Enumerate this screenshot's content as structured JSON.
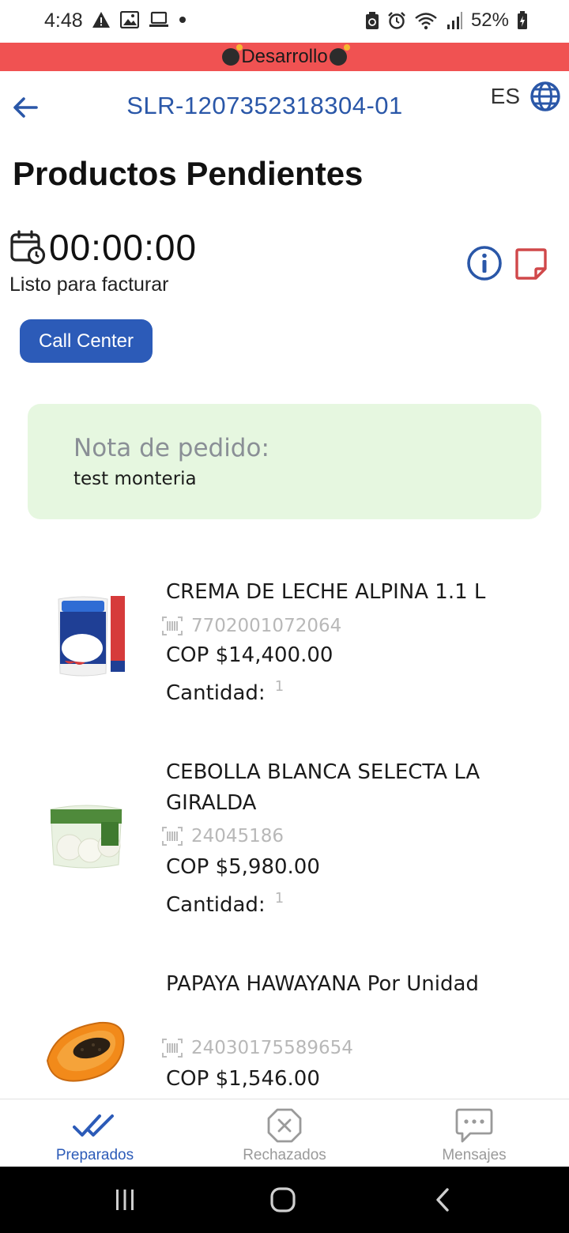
{
  "status_bar": {
    "time": "4:48",
    "battery": "52%",
    "icons_left": [
      "warning-icon",
      "image-icon",
      "laptop-icon",
      "dot-icon"
    ],
    "icons_right": [
      "recycle-icon",
      "alarm-icon",
      "wifi-icon",
      "signal-icon",
      "battery-icon"
    ]
  },
  "banner": {
    "text": "Desarrollo",
    "color": "#f05252"
  },
  "header": {
    "order_id": "SLR-1207352318304-01",
    "language": "ES"
  },
  "page": {
    "title": "Productos Pendientes",
    "timer": "00:00:00",
    "status": "Listo para facturar"
  },
  "actions": {
    "call_center": "Call Center"
  },
  "note": {
    "label": "Nota de pedido:",
    "text": "test monteria"
  },
  "products": [
    {
      "name": "CREMA DE LECHE ALPINA 1.1 L",
      "barcode": "7702001072064",
      "price": "COP $14,400.00",
      "quantity_label": "Cantidad:",
      "quantity": "1"
    },
    {
      "name": "CEBOLLA BLANCA SELECTA LA GIRALDA",
      "barcode": "24045186",
      "price": "COP $5,980.00",
      "quantity_label": "Cantidad:",
      "quantity": "1"
    },
    {
      "name": "PAPAYA HAWAYANA Por Unidad",
      "barcode": "24030175589654",
      "price": "COP $1,546.00"
    }
  ],
  "bottom_nav": [
    {
      "label": "Preparados",
      "active": true
    },
    {
      "label": "Rechazados",
      "active": false
    },
    {
      "label": "Mensajes",
      "active": false
    }
  ],
  "colors": {
    "primary": "#2c5bb8",
    "title_blue": "#2a57a8",
    "note_bg": "#e6f7e0",
    "note_icon": "#d0484a",
    "inactive": "#9a9a9a"
  }
}
